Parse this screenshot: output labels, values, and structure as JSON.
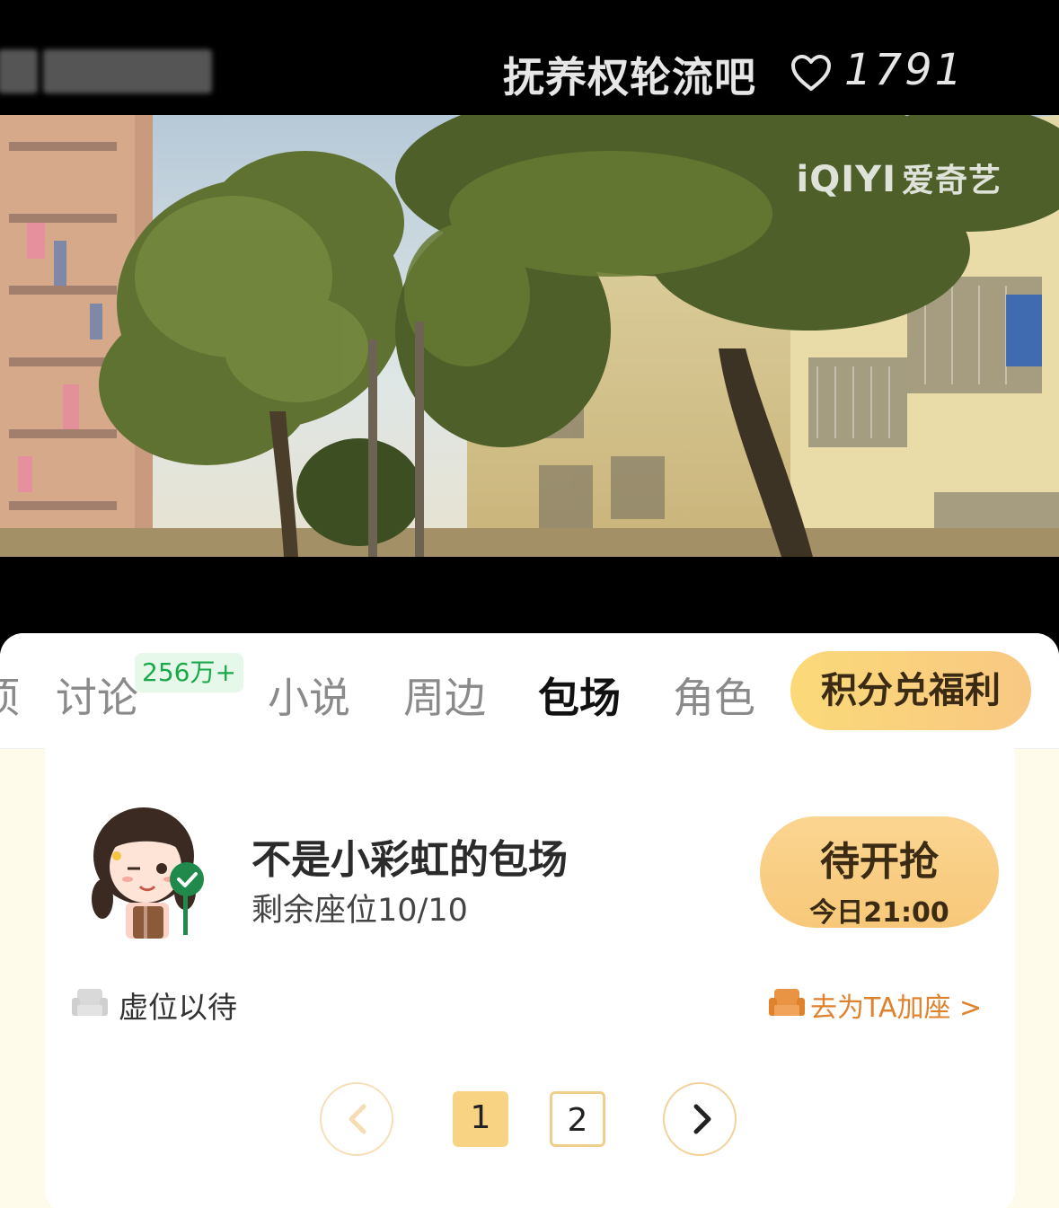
{
  "header": {
    "left_text": "云",
    "video_title": "抚养权轮流吧",
    "like_count": "1791"
  },
  "video": {
    "watermark_latin": "iQIYI",
    "watermark_cn": "爱奇艺"
  },
  "tabs": [
    {
      "label": "项"
    },
    {
      "label": "讨论",
      "badge": "256万+"
    },
    {
      "label": "小说"
    },
    {
      "label": "周边"
    },
    {
      "label": "包场",
      "active": true
    },
    {
      "label": "角色"
    }
  ],
  "points_button": "积分兑福利",
  "room": {
    "title": "不是小彩虹的包场",
    "seats": "剩余座位10/10",
    "grab_label": "待开抢",
    "grab_time": "今日21:00",
    "seat_placeholder": "虚位以待",
    "add_seat_link": "去为TA加座 >"
  },
  "pagination": {
    "pages": [
      "1",
      "2"
    ],
    "current": "1"
  },
  "colors": {
    "accent": "#f9d384",
    "link": "#e0812c",
    "badge_green": "#1aa84a",
    "panel_bg": "#fffbea"
  }
}
